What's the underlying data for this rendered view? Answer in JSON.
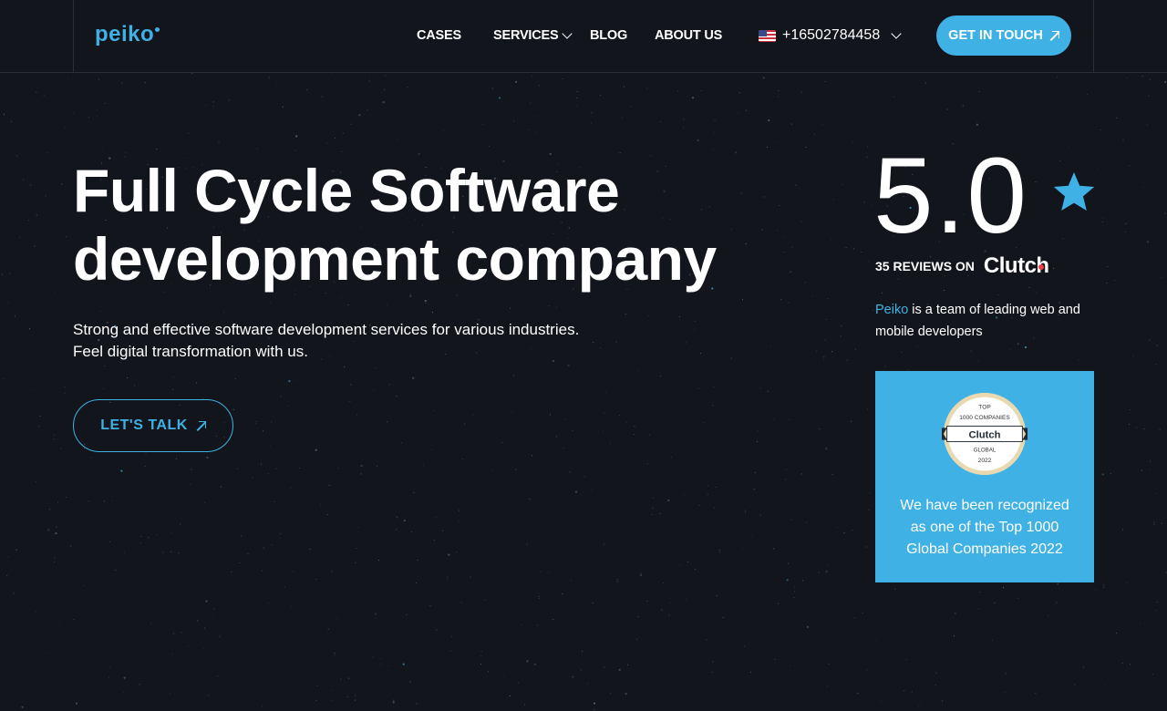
{
  "header": {
    "logo": "peiko",
    "nav": [
      {
        "label": "CASES"
      },
      {
        "label": "SERVICES"
      },
      {
        "label": "BLOG"
      },
      {
        "label": "ABOUT US"
      }
    ],
    "phone": "+16502784458",
    "cta_label": "GET IN TOUCH"
  },
  "hero": {
    "title_line1": "Full Cycle Software",
    "title_line2": "development company",
    "subtitle_line1": "Strong and effective software development services for various industries.",
    "subtitle_line2": "Feel digital transformation with us.",
    "cta_label": "LET'S TALK"
  },
  "rating": {
    "score": "5.0",
    "reviews_label": "35 REVIEWS ON",
    "reviews_source": "Clutch"
  },
  "about": {
    "brand": "Peiko",
    "text": " is a team of leading web and mobile developers"
  },
  "award": {
    "badge_top": "TOP",
    "badge_line2": "1000 COMPANIES",
    "badge_brand": "Clutch",
    "badge_line4": "GLOBAL",
    "badge_year": "2022",
    "text_line1": "We have been recognized",
    "text_line2": "as one of the Top 1000",
    "text_line3": "Global Companies 2022"
  },
  "colors": {
    "background": "#12151c",
    "accent": "#3fb1e5",
    "text": "#ffffff",
    "clutch_red": "#ef3f45"
  },
  "icons": [
    "us-flag-icon",
    "chevron-down-icon",
    "arrow-up-right-icon",
    "star-icon",
    "clutch-badge-icon"
  ]
}
